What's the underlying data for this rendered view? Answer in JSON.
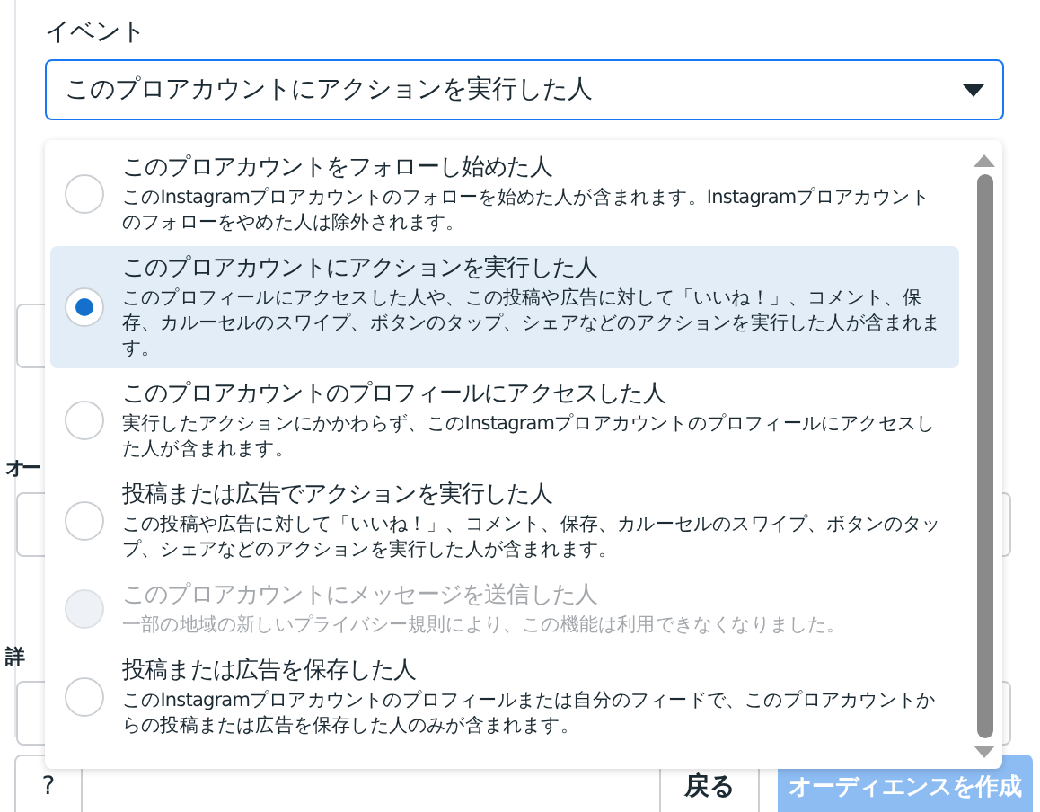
{
  "event": {
    "label": "イベント",
    "value": "このプロアカウントにアクションを実行した人"
  },
  "options": [
    {
      "title": "このプロアカウントをフォローし始めた人",
      "description": "このInstagramプロアカウントのフォローを始めた人が含まれます。Instagramプロアカウントのフォローをやめた人は除外されます。",
      "selected": false,
      "disabled": false
    },
    {
      "title": "このプロアカウントにアクションを実行した人",
      "description": "このプロフィールにアクセスした人や、この投稿や広告に対して「いいね！」、コメント、保存、カルーセルのスワイプ、ボタンのタップ、シェアなどのアクションを実行した人が含まれます。",
      "selected": true,
      "disabled": false
    },
    {
      "title": "このプロアカウントのプロフィールにアクセスした人",
      "description": "実行したアクションにかかわらず、このInstagramプロアカウントのプロフィールにアクセスした人が含まれます。",
      "selected": false,
      "disabled": false
    },
    {
      "title": "投稿または広告でアクションを実行した人",
      "description": "この投稿や広告に対して「いいね！」、コメント、保存、カルーセルのスワイプ、ボタンのタップ、シェアなどのアクションを実行した人が含まれます。",
      "selected": false,
      "disabled": false
    },
    {
      "title": "このプロアカウントにメッセージを送信した人",
      "description": "一部の地域の新しいプライバシー規則により、この機能は利用できなくなりました。",
      "selected": false,
      "disabled": true
    },
    {
      "title": "投稿または広告を保存した人",
      "description": "このInstagramプロアカウントのプロフィールまたは自分のフィードで、このプロアカウントからの投稿または広告を保存した人のみが含まれます。",
      "selected": false,
      "disabled": false
    }
  ],
  "background_labels": [
    "オー",
    "詳"
  ],
  "footer": {
    "help_button": "?",
    "back_button": "戻る",
    "create_button": {
      "label": "オーディエンスを作成",
      "disabled": true
    }
  }
}
